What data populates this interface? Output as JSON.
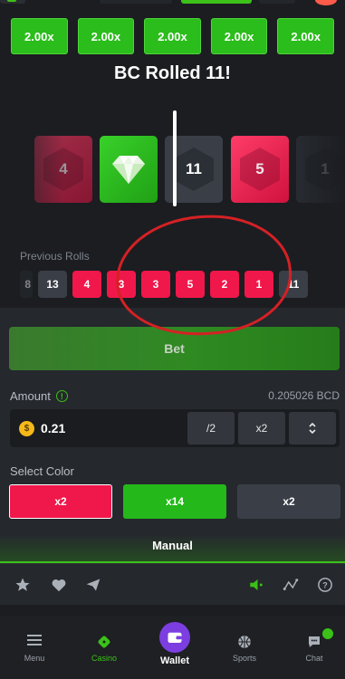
{
  "multipliers": [
    "2.00x",
    "2.00x",
    "2.00x",
    "2.00x",
    "2.00x"
  ],
  "result_title": "BC Rolled 11!",
  "tiles": [
    {
      "label": "4",
      "color": "red"
    },
    {
      "label": "",
      "color": "green",
      "icon": "diamond-icon"
    },
    {
      "label": "11",
      "color": "gray"
    },
    {
      "label": "5",
      "color": "red"
    },
    {
      "label": "1",
      "color": "gray"
    }
  ],
  "previous_rolls": {
    "label": "Previous Rolls",
    "values": [
      {
        "v": "8",
        "c": "faded"
      },
      {
        "v": "13",
        "c": "gray"
      },
      {
        "v": "4",
        "c": "red"
      },
      {
        "v": "3",
        "c": "red"
      },
      {
        "v": "3",
        "c": "red"
      },
      {
        "v": "5",
        "c": "red"
      },
      {
        "v": "2",
        "c": "red"
      },
      {
        "v": "1",
        "c": "red"
      },
      {
        "v": "11",
        "c": "gray"
      }
    ]
  },
  "bet": {
    "button_label": "Bet",
    "amount_label": "Amount",
    "balance": "0.205026 BCD",
    "amount_value": "0.21",
    "coin_symbol": "$",
    "half_label": "/2",
    "double_label": "x2",
    "range_up": "⌃",
    "range_down": "⌄"
  },
  "select_color": {
    "label": "Select Color",
    "red_label": "x2",
    "green_label": "x14",
    "gray_label": "x2"
  },
  "mode_tab": "Manual",
  "nav": {
    "menu": "Menu",
    "casino": "Casino",
    "wallet": "Wallet",
    "sports": "Sports",
    "chat": "Chat"
  },
  "colors": {
    "accent_green": "#3bc117",
    "red": "#f0174a",
    "wallet_purple": "#7c3ee0",
    "annotation": "#d42125"
  }
}
